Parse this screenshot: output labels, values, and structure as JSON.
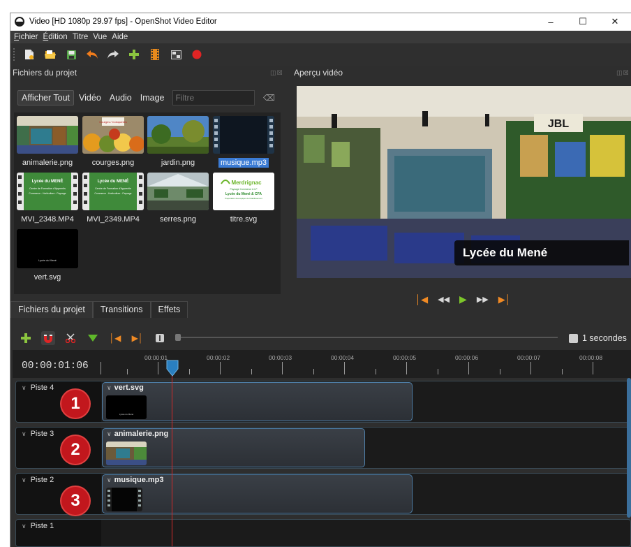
{
  "window": {
    "title": "Video [HD 1080p 29.97 fps] - OpenShot Video Editor",
    "minimize": "–",
    "maximize": "☐",
    "close": "✕"
  },
  "menu": [
    {
      "label": "Fichier",
      "underline": "F",
      "rest": "ichier"
    },
    {
      "label": "Édition",
      "underline": "É",
      "rest": "dition"
    },
    {
      "label": "Titre"
    },
    {
      "label": "Vue"
    },
    {
      "label": "Aide"
    }
  ],
  "toolbar_icons": [
    "new-project-icon",
    "open-project-icon",
    "save-project-icon",
    "undo-icon",
    "redo-icon",
    "import-files-icon",
    "choose-profile-icon",
    "fullscreen-icon",
    "export-video-icon"
  ],
  "files_panel": {
    "title": "Fichiers du projet",
    "filters": [
      "Afficher Tout",
      "Vidéo",
      "Audio",
      "Image"
    ],
    "filter_placeholder": "Filtre",
    "items": [
      {
        "name": "animalerie.png",
        "kind": "image-shop"
      },
      {
        "name": "courges.png",
        "kind": "image-squash"
      },
      {
        "name": "jardin.png",
        "kind": "image-garden"
      },
      {
        "name": "musique.mp3",
        "kind": "audio",
        "selected": true
      },
      {
        "name": "MVI_2348.MP4",
        "kind": "video-lycee"
      },
      {
        "name": "MVI_2349.MP4",
        "kind": "video-lycee"
      },
      {
        "name": "serres.png",
        "kind": "image-greenhouse"
      },
      {
        "name": "titre.svg",
        "kind": "svg-title"
      },
      {
        "name": "vert.svg",
        "kind": "svg-black"
      }
    ],
    "thumb_text": {
      "lycee_line1": "Lycée du MENÉ",
      "lycee_line2": "Centre de Formation d'Apprentis",
      "lycee_line3": "Commerce - Horticulture - Paysage",
      "titre_brand": "Merdrignac",
      "titre_line1": "Paysage Commerce & LP",
      "titre_line2": "Lycée du Mené & CFA",
      "titre_line3": "Préparation des équipes de l'établissement",
      "vert_text": "Lycée du Mené",
      "squash_sign": "Courges / Coloquintes"
    }
  },
  "bottom_tabs": [
    "Fichiers du projet",
    "Transitions",
    "Effets"
  ],
  "preview": {
    "title": "Aperçu vidéo",
    "caption": "Lycée du Mené",
    "sign": "JBL"
  },
  "timeline": {
    "timecode": "00:00:01:06",
    "scale": "1 secondes",
    "ticks": [
      "00:00:01",
      "00:00:02",
      "00:00:03",
      "00:00:04",
      "00:00:05",
      "00:00:06",
      "00:00:07",
      "00:00:08"
    ],
    "tracks": [
      {
        "name": "Piste 4",
        "clip": "vert.svg",
        "badge": "1"
      },
      {
        "name": "Piste 3",
        "clip": "animalerie.png",
        "badge": "2"
      },
      {
        "name": "Piste 2",
        "clip": "musique.mp3",
        "badge": "3"
      },
      {
        "name": "Piste 1"
      }
    ]
  },
  "colors": {
    "accent": "#3b7bd4",
    "playhead": "#d42a2a",
    "badge": "#c2171d",
    "clip_border": "#4f7fa8",
    "play": "#7cc62a",
    "transport": "#f08a24"
  }
}
